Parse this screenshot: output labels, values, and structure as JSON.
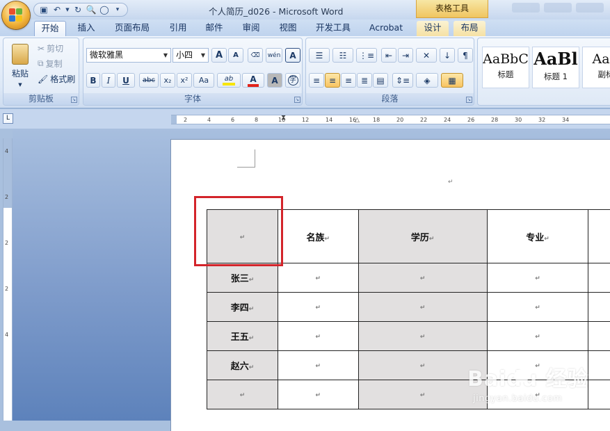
{
  "window": {
    "title": "个人简历_d026 - Microsoft Word",
    "contextual_label": "表格工具"
  },
  "quick_access": {
    "icons": [
      "save-icon",
      "undo-icon",
      "redo-icon",
      "print-preview-icon",
      "circle-icon",
      "customize-icon"
    ]
  },
  "tabs": [
    {
      "label": "开始",
      "active": true
    },
    {
      "label": "插入"
    },
    {
      "label": "页面布局"
    },
    {
      "label": "引用"
    },
    {
      "label": "邮件"
    },
    {
      "label": "审阅"
    },
    {
      "label": "视图"
    },
    {
      "label": "开发工具"
    },
    {
      "label": "Acrobat"
    },
    {
      "label": "设计",
      "contextual": true
    },
    {
      "label": "布局",
      "contextual": true
    }
  ],
  "clipboard": {
    "title": "剪贴板",
    "paste": "粘贴",
    "cut": "剪切",
    "copy": "复制",
    "format_painter": "格式刷"
  },
  "font": {
    "title": "字体",
    "family": "微软雅黑",
    "size": "小四",
    "bold": "B",
    "italic": "I",
    "underline": "U",
    "strike": "abc",
    "subscript": "x₂",
    "superscript": "x²",
    "change_case": "Aa",
    "grow": "A",
    "shrink": "A",
    "phonetic": "wén",
    "border": "A",
    "highlight": "ab",
    "font_color": "A",
    "shade": "A",
    "enclose": "字",
    "colors": {
      "highlight": "#f7e500",
      "font": "#e2231a"
    }
  },
  "paragraph": {
    "title": "段落"
  },
  "styles": [
    {
      "sample": "AaBbC",
      "name": "标题"
    },
    {
      "sample": "AaBl",
      "name": "标题 1"
    },
    {
      "sample": "AaB",
      "name": "副标"
    }
  ],
  "ruler": {
    "h_labels": [
      "2",
      "4",
      "6",
      "8",
      "10",
      "12",
      "14",
      "16",
      "18",
      "20",
      "22",
      "24",
      "26",
      "28",
      "30",
      "32",
      "34"
    ],
    "v_labels": [
      "4",
      "2",
      "2",
      "2",
      "4"
    ]
  },
  "document": {
    "para_mark": "↵",
    "table": {
      "header": [
        "",
        "名族",
        "学历",
        "专业"
      ],
      "rows": [
        [
          "张三",
          "",
          "",
          ""
        ],
        [
          "李四",
          "",
          "",
          ""
        ],
        [
          "王五",
          "",
          "",
          ""
        ],
        [
          "赵六",
          "",
          "",
          ""
        ],
        [
          "",
          "",
          "",
          ""
        ]
      ]
    }
  },
  "watermark": {
    "logo": "Baidu 经验",
    "url": "jingyan.baidu.com"
  }
}
